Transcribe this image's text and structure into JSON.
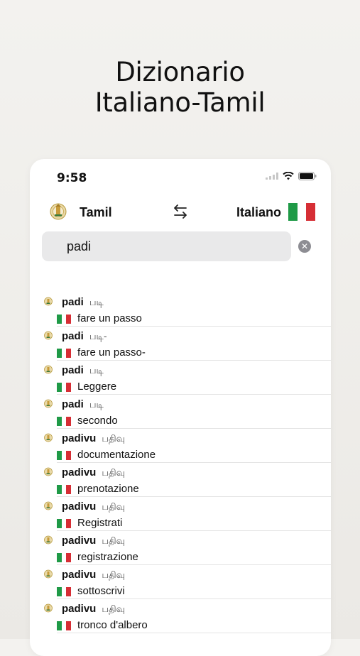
{
  "headline": {
    "line1": "Dizionario",
    "line2": "Italiano-Tamil"
  },
  "status": {
    "time": "9:58"
  },
  "lang_bar": {
    "from": "Tamil",
    "to": "Italiano"
  },
  "search": {
    "value": "padi",
    "clear_label": "✕"
  },
  "colors": {
    "flag_green": "#1f9a47",
    "flag_red": "#d62e35",
    "search_bg": "#e9e9ea"
  },
  "results": [
    {
      "word": "padi",
      "tamil": "படி",
      "translation": "fare un passo"
    },
    {
      "word": "padi",
      "tamil": "படி-",
      "translation": "fare un passo-"
    },
    {
      "word": "padi",
      "tamil": "படி",
      "translation": "Leggere"
    },
    {
      "word": "padi",
      "tamil": "படி",
      "translation": "secondo"
    },
    {
      "word": "padivu",
      "tamil": "பதிவு",
      "translation": "documentazione"
    },
    {
      "word": "padivu",
      "tamil": "பதிவு",
      "translation": "prenotazione"
    },
    {
      "word": "padivu",
      "tamil": "பதிவு",
      "translation": "Registrati"
    },
    {
      "word": "padivu",
      "tamil": "பதிவு",
      "translation": "registrazione"
    },
    {
      "word": "padivu",
      "tamil": "பதிவு",
      "translation": "sottoscrivi"
    },
    {
      "word": "padivu",
      "tamil": "பதிவு",
      "translation": "tronco d'albero"
    }
  ]
}
